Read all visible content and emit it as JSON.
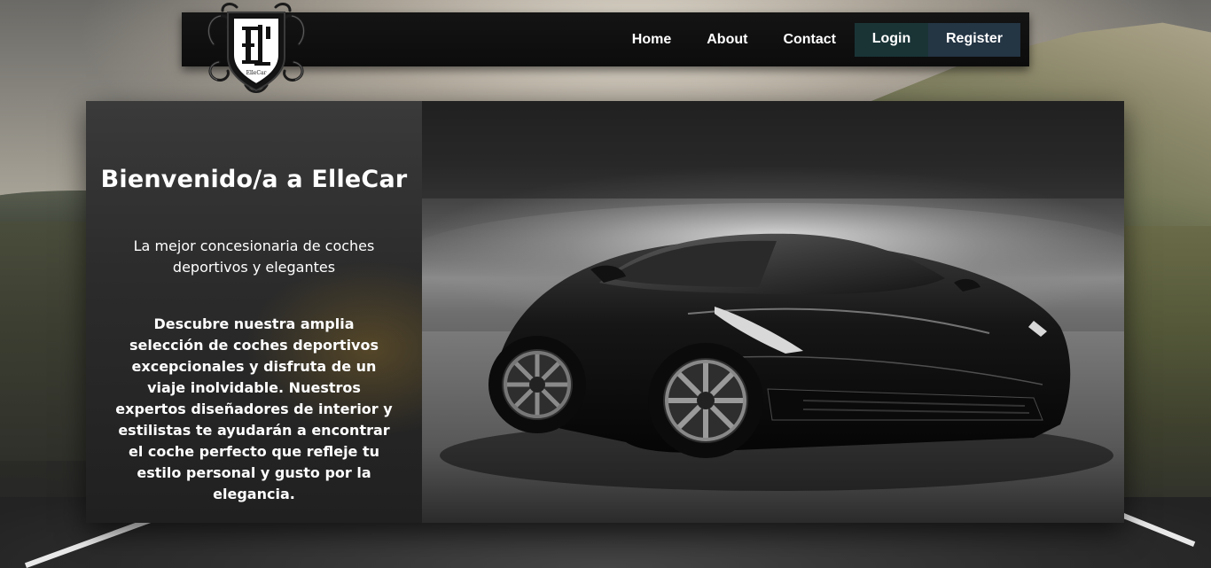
{
  "brand": {
    "logo_text": "ElleCar",
    "logo_monogram": "EL"
  },
  "nav": {
    "links": [
      "Home",
      "About",
      "Contact"
    ],
    "login_label": "Login",
    "register_label": "Register"
  },
  "hero": {
    "title": "Bienvenido/a a ElleCar",
    "subtitle": "La mejor concesionaria de coches deportivos y elegantes",
    "description": "Descubre nuestra amplia selección de coches deportivos excepcionales y disfruta de un viaje inolvidable. Nuestros expertos diseñadores de interior y estilistas te ayudarán a encontrar el coche perfecto que refleje tu estilo personal y gusto por la elegancia.",
    "image_alt": "black sports car"
  },
  "colors": {
    "navbar_bg": "#0c0c0c",
    "login_bg": "#1a3436",
    "register_bg": "#243544",
    "text": "#ffffff"
  }
}
